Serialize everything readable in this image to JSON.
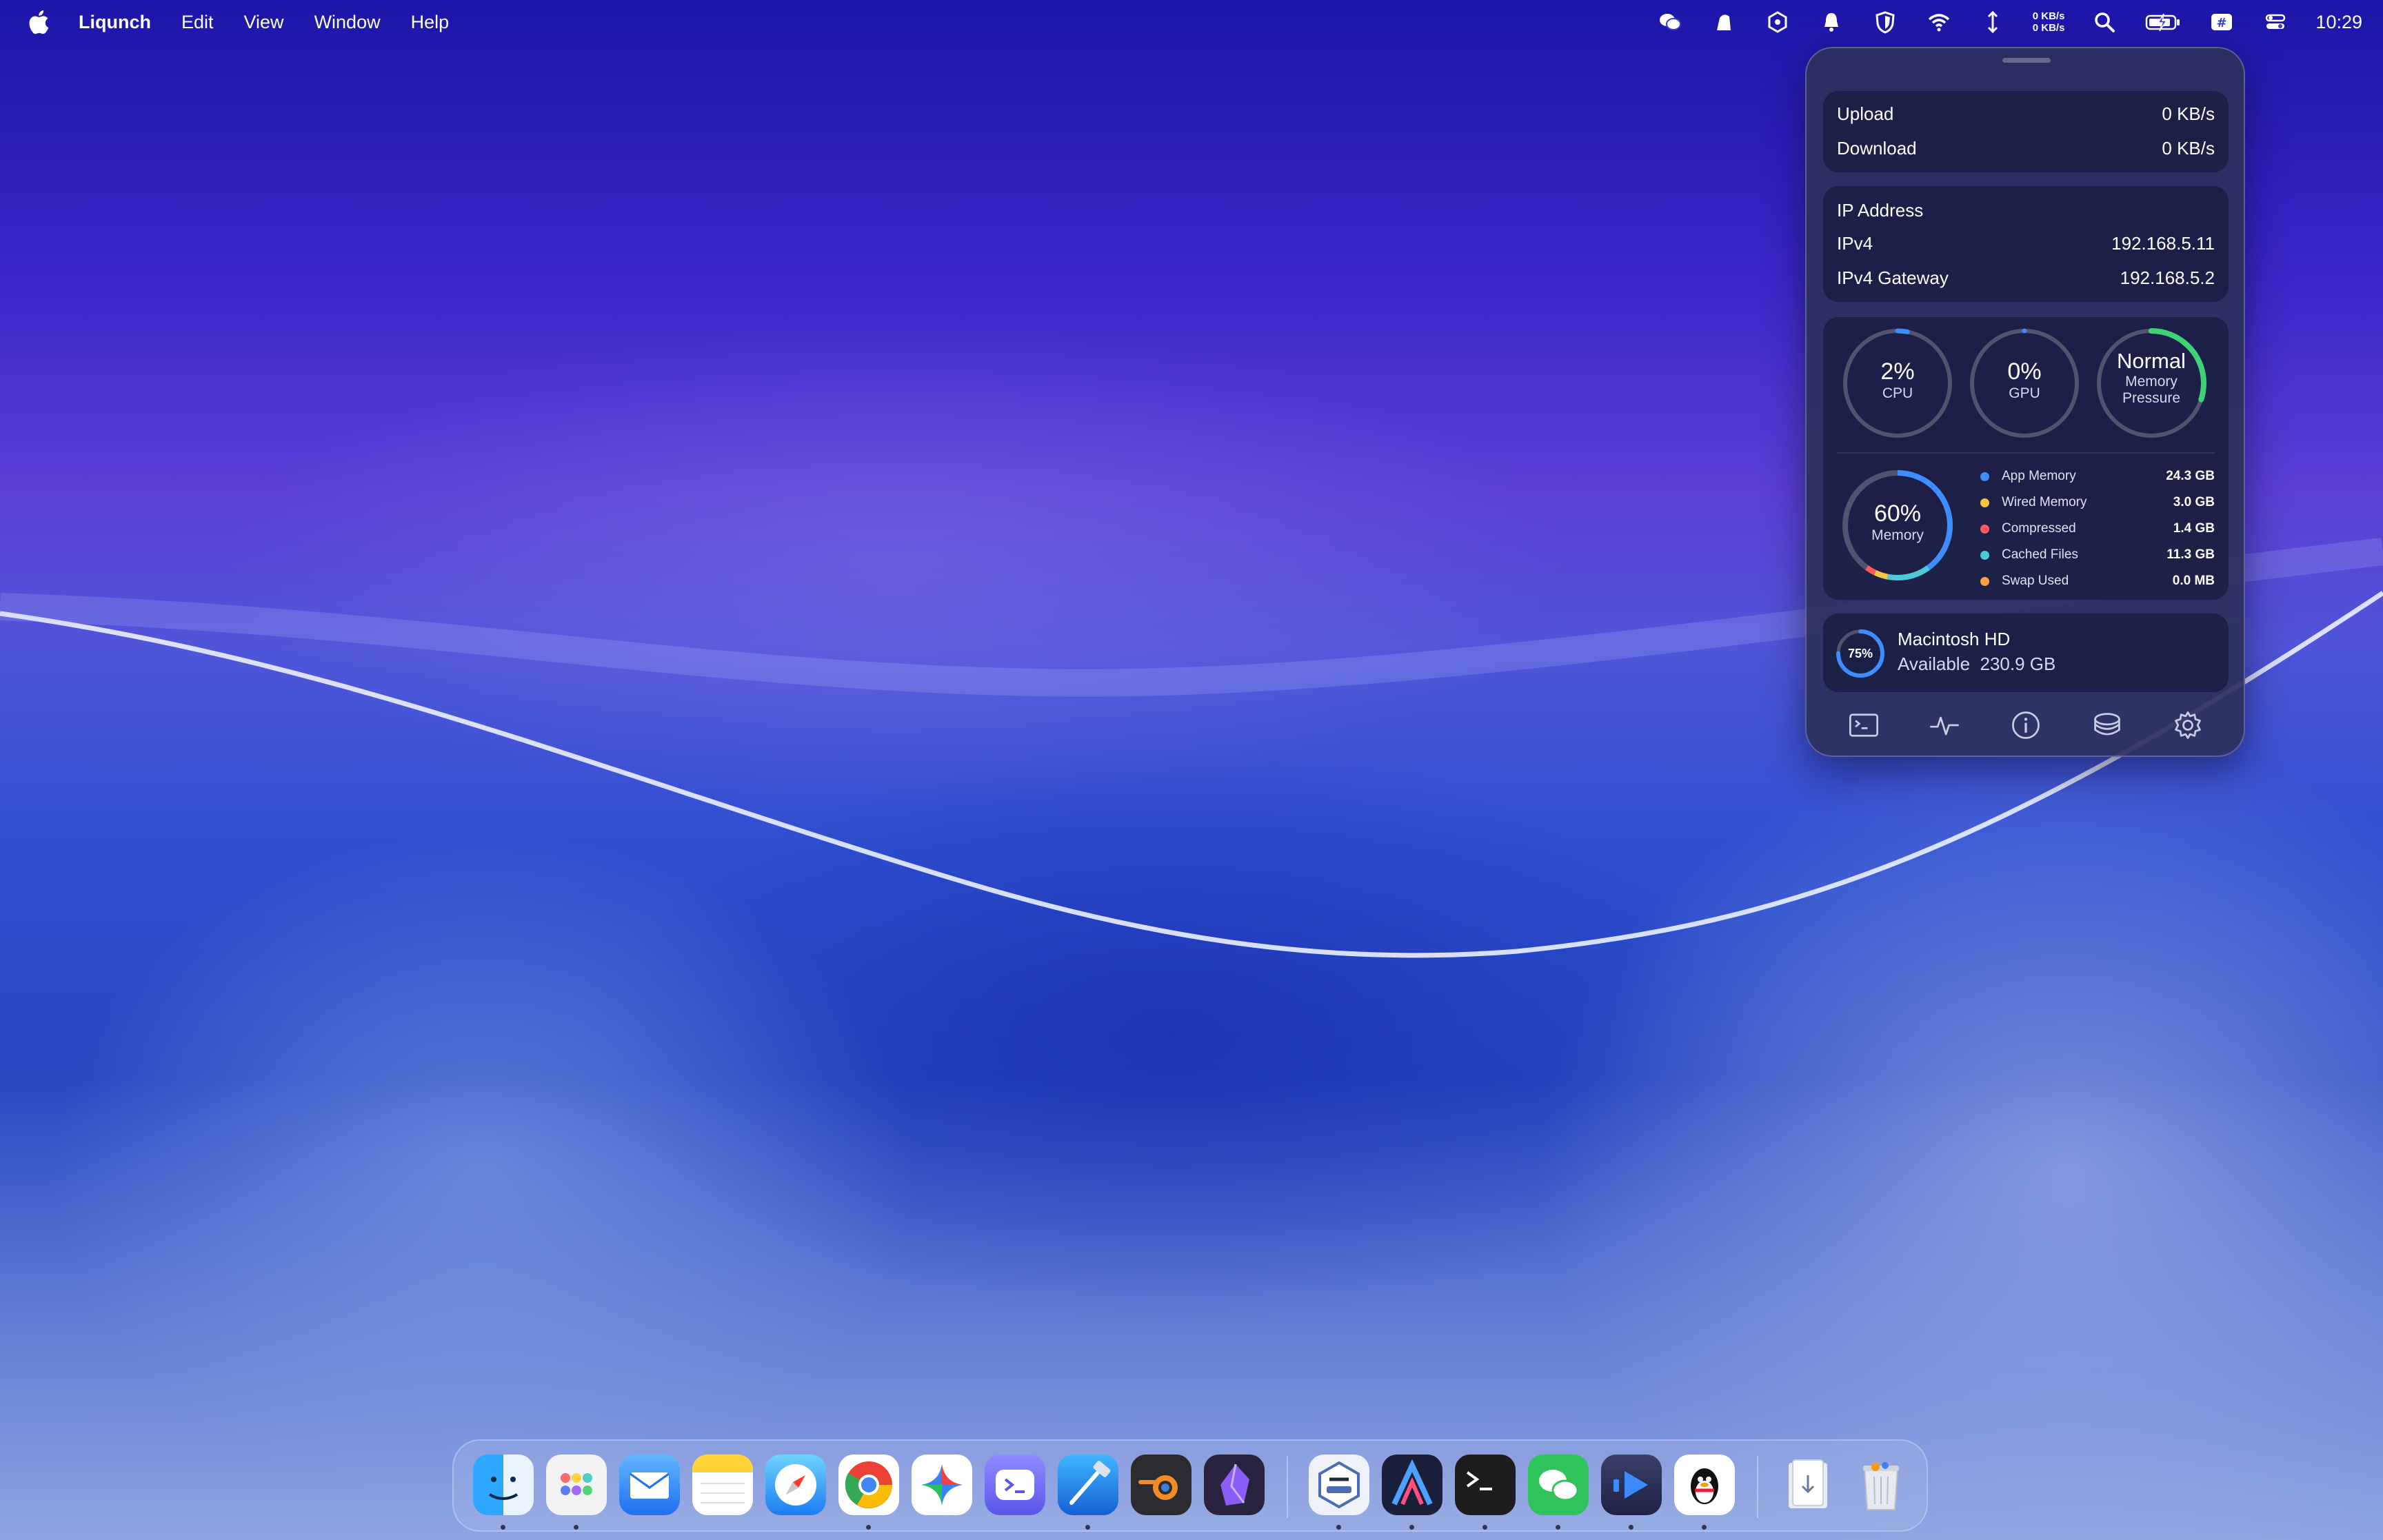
{
  "menubar": {
    "app_name": "Liqunch",
    "menus": [
      "Edit",
      "View",
      "Window",
      "Help"
    ],
    "net_up": "0 KB/s",
    "net_down": "0 KB/s",
    "time": "10:29",
    "status_icons": [
      "wechat-icon",
      "cleaner-icon",
      "hexagon-icon",
      "notification-bell-icon",
      "shield-icon",
      "wifi-icon",
      "updown-arrow-icon",
      "netspeed",
      "search-icon",
      "battery-charging-icon",
      "input-method-icon",
      "control-center-icon"
    ]
  },
  "panel": {
    "network": {
      "upload_label": "Upload",
      "upload_value": "0 KB/s",
      "download_label": "Download",
      "download_value": "0 KB/s"
    },
    "ip": {
      "title": "IP Address",
      "ipv4_label": "IPv4",
      "ipv4_value": "192.168.5.11",
      "gateway_label": "IPv4 Gateway",
      "gateway_value": "192.168.5.2"
    },
    "gauges": {
      "cpu": {
        "value": "2%",
        "label": "CPU",
        "fraction": 0.02
      },
      "gpu": {
        "value": "0%",
        "label": "GPU",
        "fraction": 0.0
      },
      "pressure": {
        "value": "Normal",
        "label_line1": "Memory",
        "label_line2": "Pressure",
        "fraction": 0.3
      }
    },
    "memory": {
      "value": "60%",
      "label": "Memory",
      "fraction": 0.6,
      "items": [
        {
          "label": "App Memory",
          "value": "24.3 GB",
          "color": "#3f8cff"
        },
        {
          "label": "Wired Memory",
          "value": "3.0 GB",
          "color": "#f5c542"
        },
        {
          "label": "Compressed",
          "value": "1.4 GB",
          "color": "#ff5a5a"
        },
        {
          "label": "Cached Files",
          "value": "11.3 GB",
          "color": "#4ec9d9"
        },
        {
          "label": "Swap Used",
          "value": "0.0 MB",
          "color": "#ff9f43"
        }
      ]
    },
    "disk": {
      "percent": "75%",
      "fraction": 0.75,
      "name": "Macintosh HD",
      "available": "Available  230.9 GB"
    },
    "toolbar": [
      "terminal-icon",
      "activity-icon",
      "info-icon",
      "disk-stack-icon",
      "settings-gear-icon"
    ]
  },
  "dock": {
    "apps": [
      "finder",
      "launchpad",
      "mail",
      "notes",
      "safari",
      "chrome",
      "gemini",
      "remote-shell",
      "xcode",
      "blender",
      "obsidian",
      "aoct",
      "affinity",
      "terminal",
      "wechat",
      "video-player",
      "qq",
      "downloads",
      "trash"
    ]
  },
  "colors": {
    "accent_blue": "#3f8cff",
    "pressure_green": "#3fd17a",
    "panel_bg": "#2c305c"
  }
}
